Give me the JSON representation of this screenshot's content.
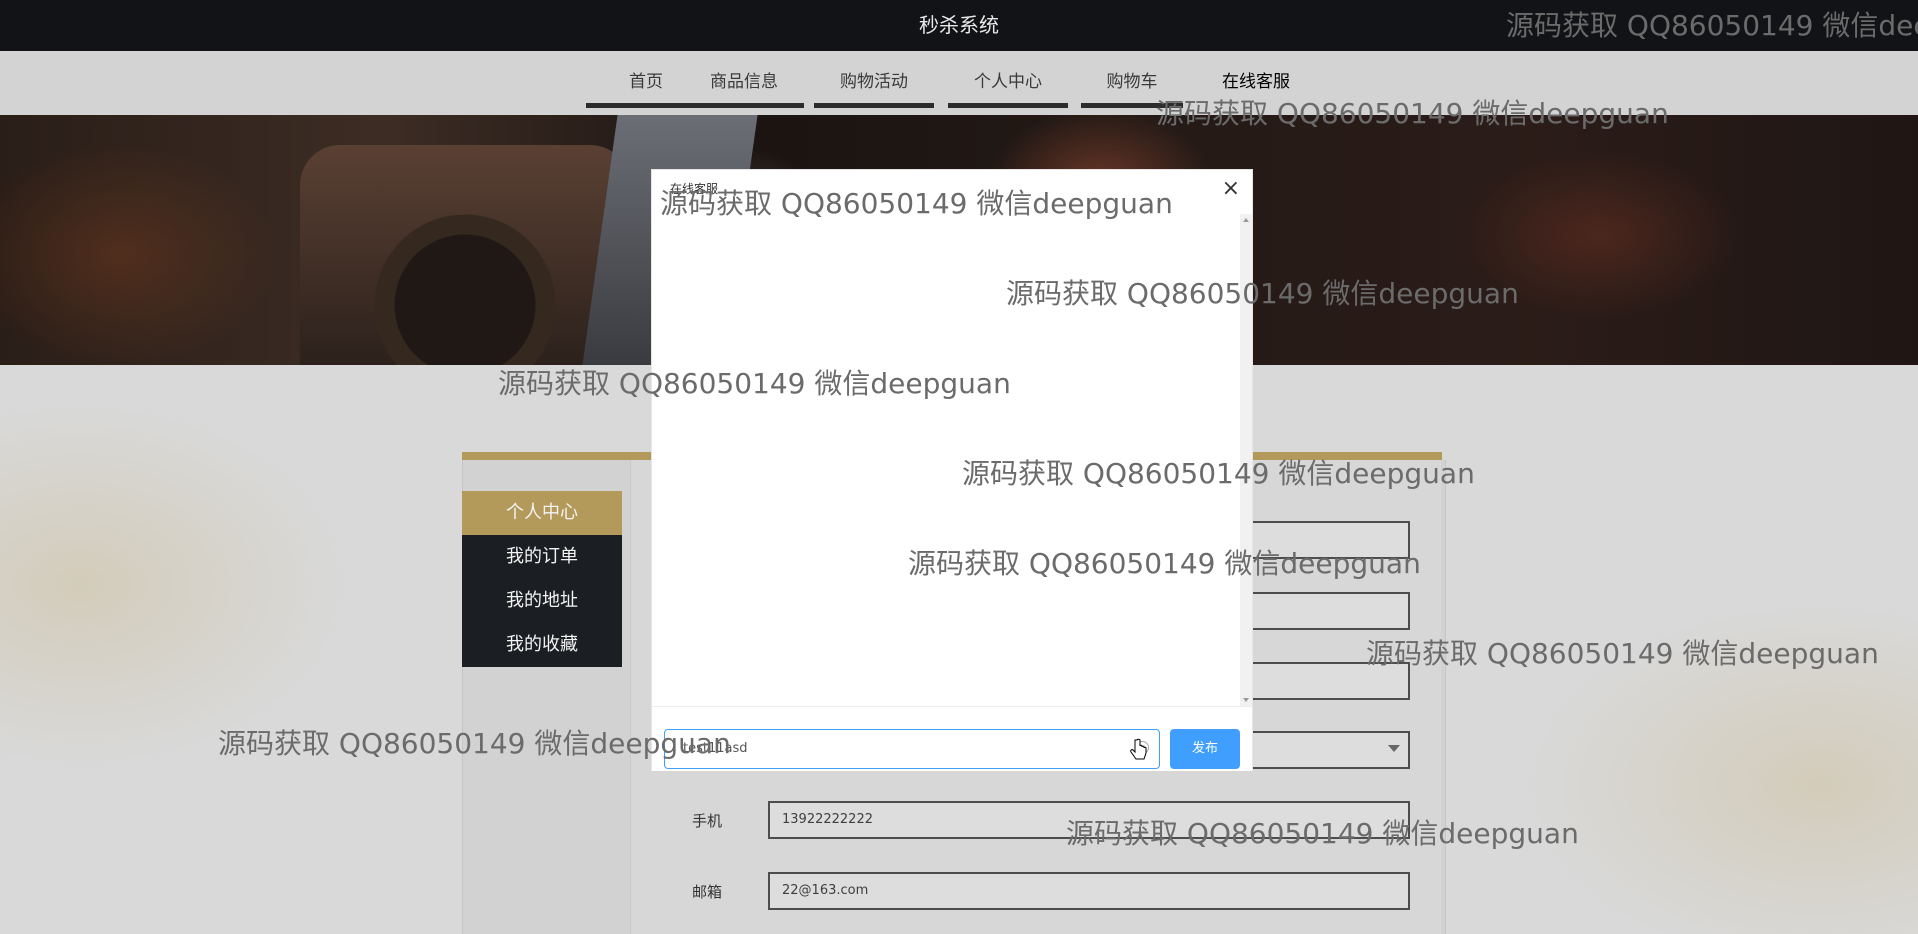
{
  "app_title": "秒杀系统",
  "nav": {
    "items": [
      "首页",
      "商品信息",
      "购物活动",
      "个人中心",
      "购物车",
      "在线客服"
    ],
    "active_index": 5
  },
  "sidebar": {
    "items": [
      "个人中心",
      "我的订单",
      "我的地址",
      "我的收藏"
    ],
    "active_index": 0
  },
  "form": {
    "phone_label": "手机",
    "phone_value": "13922222222",
    "email_label": "邮箱",
    "email_value": "22@163.com"
  },
  "modal": {
    "title": "在线客服",
    "close_symbol": "×",
    "input_value": "test11asd",
    "publish_label": "发布"
  },
  "watermark_text": "源码获取 QQ86050149 微信deepguan",
  "colors": {
    "gold": "#b39a5b",
    "dark": "#1b1e22",
    "primary_blue": "#409eff"
  }
}
